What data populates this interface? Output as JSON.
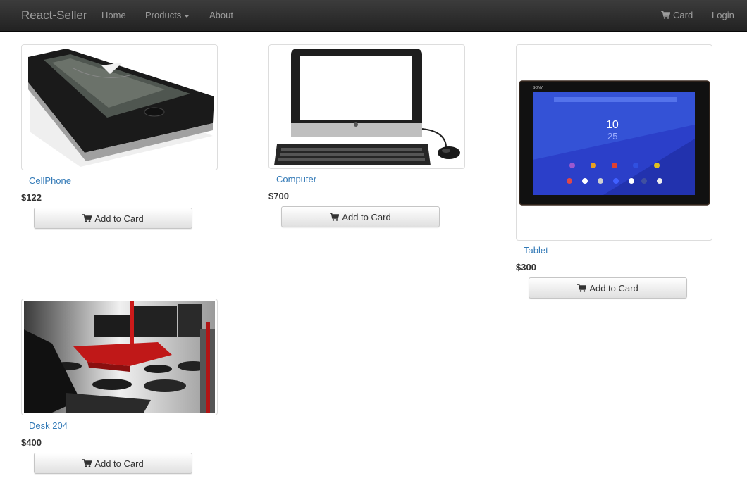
{
  "navbar": {
    "brand": "React-Seller",
    "links": {
      "home": "Home",
      "products": "Products",
      "about": "About",
      "card": "Card",
      "login": "Login"
    }
  },
  "products": [
    {
      "name": "CellPhone",
      "price": "$122",
      "button": "Add to Card",
      "image": "cellphone"
    },
    {
      "name": "Computer",
      "price": "$700",
      "button": "Add to Card",
      "image": "computer"
    },
    {
      "name": "Tablet",
      "price": "$300",
      "button": "Add to Card",
      "image": "tablet"
    },
    {
      "name": "Desk 204",
      "price": "$400",
      "button": "Add to Card",
      "image": "desk"
    }
  ],
  "tablet_screen": {
    "brand": "SONY",
    "time": "10",
    "time2": "25"
  },
  "icons": {
    "cart": "cart-icon",
    "caret": "caret-down-icon"
  },
  "colors": {
    "navbar": "#222222",
    "link": "#337ab7",
    "brand_text": "#9d9d9d"
  }
}
